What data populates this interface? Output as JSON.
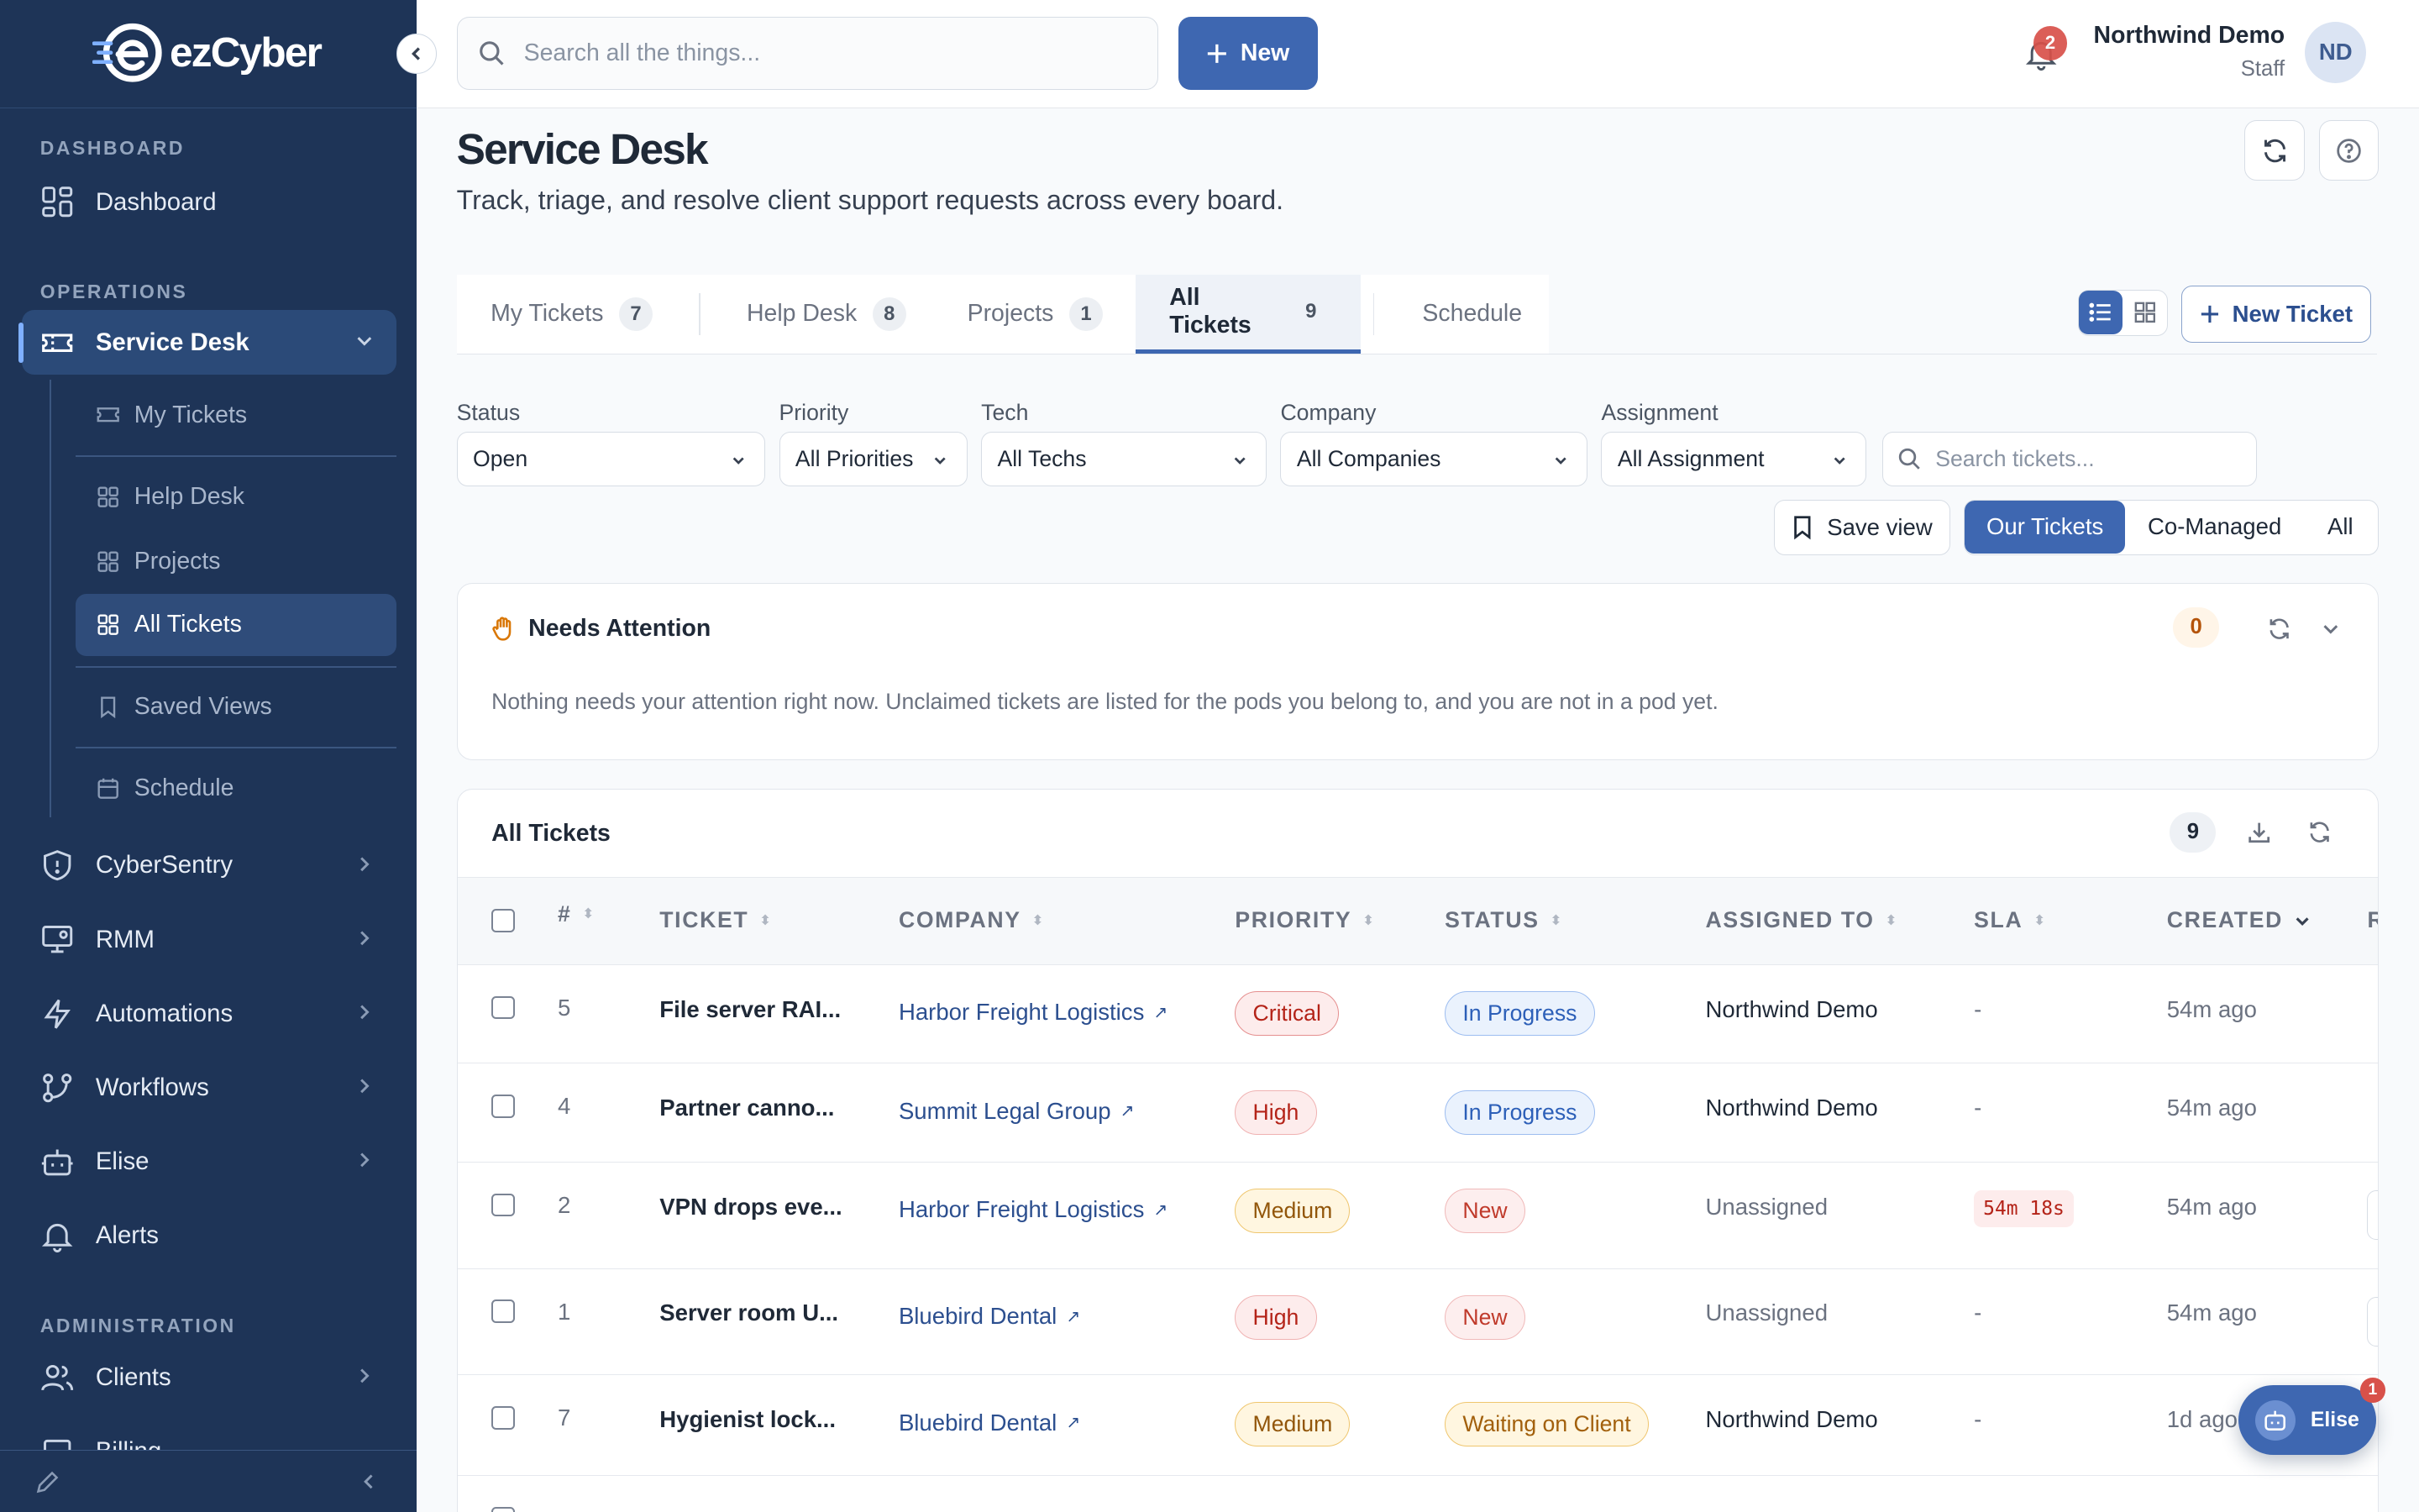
{
  "brand": {
    "logo_text": "ezCyber"
  },
  "sidebar": {
    "sections": {
      "dashboard": "DASHBOARD",
      "operations": "OPERATIONS",
      "administration": "ADMINISTRATION"
    },
    "items": {
      "dashboard": "Dashboard",
      "service_desk": "Service Desk",
      "cybersentry": "CyberSentry",
      "rmm": "RMM",
      "automations": "Automations",
      "workflows": "Workflows",
      "elise": "Elise",
      "alerts": "Alerts",
      "clients": "Clients",
      "billing": "Billing"
    },
    "subitems": {
      "my_tickets": "My Tickets",
      "help_desk": "Help Desk",
      "projects": "Projects",
      "all_tickets": "All Tickets",
      "saved_views": "Saved Views",
      "schedule": "Schedule"
    }
  },
  "topbar": {
    "search_placeholder": "Search all the things...",
    "new_label": "New",
    "notifications": "2",
    "user_name": "Northwind Demo",
    "user_role": "Staff",
    "initials": "ND"
  },
  "page": {
    "title": "Service Desk",
    "subtitle": "Track, triage, and resolve client support requests across every board."
  },
  "tabs": [
    {
      "label": "My Tickets",
      "count": "7"
    },
    {
      "label": "Help Desk",
      "count": "8"
    },
    {
      "label": "Projects",
      "count": "1"
    },
    {
      "label": "All Tickets",
      "count": "9"
    },
    {
      "label": "Schedule"
    }
  ],
  "new_ticket_label": "New Ticket",
  "filters": {
    "status": {
      "label": "Status",
      "value": "Open"
    },
    "priority": {
      "label": "Priority",
      "value": "All Priorities"
    },
    "tech": {
      "label": "Tech",
      "value": "All Techs"
    },
    "company": {
      "label": "Company",
      "value": "All Companies"
    },
    "assignment": {
      "label": "Assignment",
      "value": "All Assignment"
    },
    "search_placeholder": "Search tickets..."
  },
  "save_view_label": "Save view",
  "scope": {
    "ours": "Our Tickets",
    "co": "Co-Managed",
    "all": "All"
  },
  "needs_attention": {
    "title": "Needs Attention",
    "count": "0",
    "message": "Nothing needs your attention right now. Unclaimed tickets are listed for the pods you belong to, and you are not in a pod yet."
  },
  "all_tickets": {
    "title": "All Tickets",
    "count": "9",
    "columns": {
      "num": "#",
      "ticket": "TICKET",
      "company": "COMPANY",
      "priority": "PRIORITY",
      "status": "STATUS",
      "assigned": "ASSIGNED TO",
      "sla": "SLA",
      "created": "CREATED",
      "extra": "R"
    },
    "rows": [
      {
        "num": "5",
        "ticket": "File server RAI...",
        "company": "Harbor Freight Logistics",
        "priority": "Critical",
        "status": "In Progress",
        "assigned": "Northwind Demo",
        "sla": "-",
        "created": "54m ago"
      },
      {
        "num": "4",
        "ticket": "Partner canno...",
        "company": "Summit Legal Group",
        "priority": "High",
        "status": "In Progress",
        "assigned": "Northwind Demo",
        "sla": "-",
        "created": "54m ago"
      },
      {
        "num": "2",
        "ticket": "VPN drops eve...",
        "company": "Harbor Freight Logistics",
        "priority": "Medium",
        "status": "New",
        "assigned": "Unassigned",
        "sla": "54m 18s",
        "created": "54m ago"
      },
      {
        "num": "1",
        "ticket": "Server room U...",
        "company": "Bluebird Dental",
        "priority": "High",
        "status": "New",
        "assigned": "Unassigned",
        "sla": "-",
        "created": "54m ago"
      },
      {
        "num": "7",
        "ticket": "Hygienist lock...",
        "company": "Bluebird Dental",
        "priority": "Medium",
        "status": "Waiting on Client",
        "assigned": "Northwind Demo",
        "sla": "-",
        "created": "1d ago"
      }
    ]
  },
  "elise_chat": {
    "label": "Elise",
    "badge": "1"
  },
  "colors": {
    "sidebar": "#1e3457",
    "accent": "#3e67b1",
    "critical": "#b42318",
    "medium": "#92560a"
  }
}
